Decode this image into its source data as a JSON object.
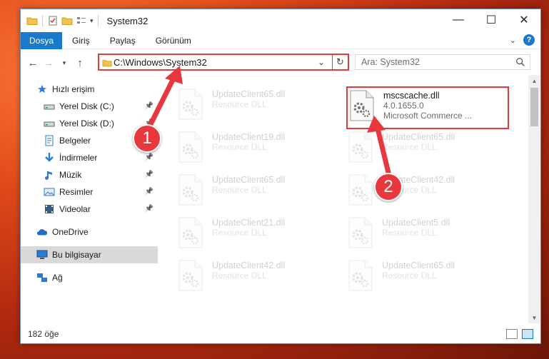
{
  "window": {
    "title": "System32"
  },
  "ribbon": {
    "tabs": [
      "Dosya",
      "Giriş",
      "Paylaş",
      "Görünüm"
    ]
  },
  "address": {
    "path": "C:\\Windows\\System32"
  },
  "search": {
    "placeholder": "Ara: System32"
  },
  "nav": {
    "items": [
      {
        "label": "Hızlı erişim",
        "icon": "star-icon"
      },
      {
        "label": "Yerel Disk (C:)",
        "icon": "drive-icon",
        "pinned": true
      },
      {
        "label": "Yerel Disk (D:)",
        "icon": "drive-icon",
        "pinned": true
      },
      {
        "label": "Belgeler",
        "icon": "documents-icon",
        "pinned": true
      },
      {
        "label": "İndirmeler",
        "icon": "download-icon",
        "pinned": true
      },
      {
        "label": "Müzik",
        "icon": "music-icon",
        "pinned": true
      },
      {
        "label": "Resimler",
        "icon": "pictures-icon",
        "pinned": true
      },
      {
        "label": "Videolar",
        "icon": "videos-icon",
        "pinned": true
      },
      {
        "label": "OneDrive",
        "icon": "cloud-icon"
      },
      {
        "label": "Bu bilgisayar",
        "icon": "computer-icon",
        "selected": true
      },
      {
        "label": "Ağ",
        "icon": "network-icon"
      }
    ]
  },
  "files": [
    {
      "name": "UpdateClient65.dll",
      "type": "Resource DLL",
      "col": 0,
      "row": 0
    },
    {
      "name": "mscscache.dll",
      "version": "4.0.1655.0",
      "type": "Microsoft Commerce ...",
      "col": 1,
      "row": 0,
      "highlighted": true
    },
    {
      "name": "UpdateClient19.dll",
      "type": "Resource DLL",
      "col": 0,
      "row": 1
    },
    {
      "name": "UpdateClient65.dll",
      "type": "Resource DLL",
      "col": 1,
      "row": 1
    },
    {
      "name": "UpdateClient65.dll",
      "type": "Resource DLL",
      "col": 0,
      "row": 2
    },
    {
      "name": "UpdateClient42.dll",
      "type": "Resource DLL",
      "col": 1,
      "row": 2
    },
    {
      "name": "UpdateClient21.dll",
      "type": "Resource DLL",
      "col": 0,
      "row": 3
    },
    {
      "name": "UpdateClient5.dll",
      "type": "Resource DLL",
      "col": 1,
      "row": 3
    },
    {
      "name": "UpdateClient42.dll",
      "type": "Resource DLL",
      "col": 0,
      "row": 4
    },
    {
      "name": "UpdateClient65.dll",
      "type": "Resource DLL",
      "col": 1,
      "row": 4
    }
  ],
  "status": {
    "count": "182 öğe"
  },
  "annotations": {
    "step1": "1",
    "step2": "2"
  },
  "colors": {
    "accent": "#1979ca",
    "highlight": "#e8383d"
  }
}
